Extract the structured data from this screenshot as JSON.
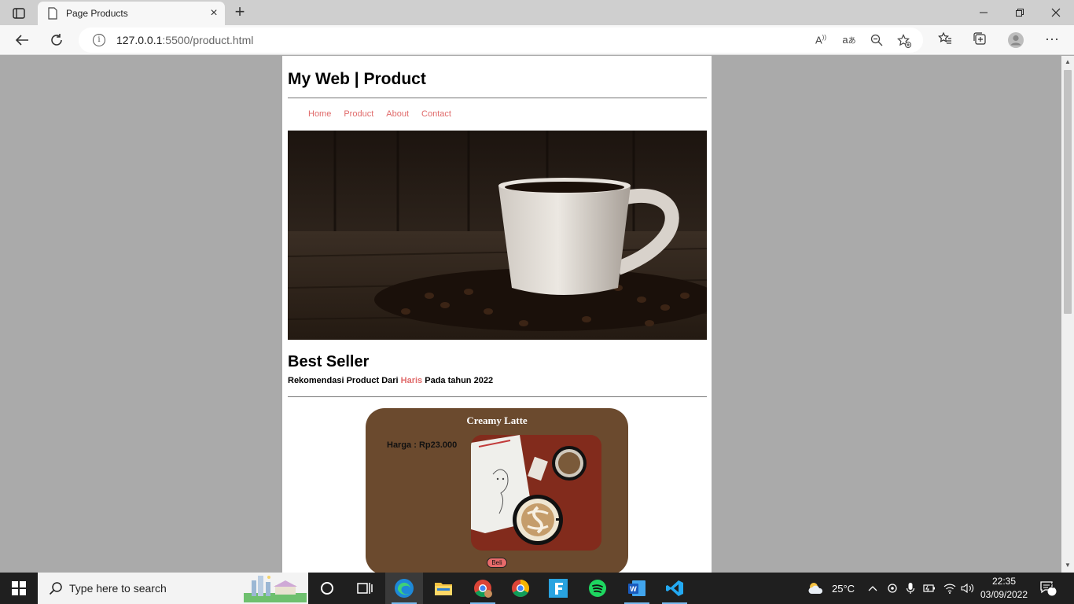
{
  "browser": {
    "tab_title": "Page Products",
    "tab_close": "×",
    "new_tab": "+",
    "url_host": "127.0.0.1",
    "url_rest": ":5500/product.html"
  },
  "site": {
    "title": "My Web | Product",
    "nav": [
      "Home",
      "Product",
      "About",
      "Contact"
    ],
    "best_seller_title": "Best Seller",
    "subtitle_pre": "Rekomendasi Product Dari ",
    "subtitle_name": "Haris",
    "subtitle_post": " Pada tahun 2022",
    "product": {
      "name": "Creamy Latte",
      "price": "Harga : Rp23.000",
      "buy_label": "Beli"
    }
  },
  "taskbar": {
    "search_placeholder": "Type here to search",
    "temperature": "25°C",
    "time": "22:35",
    "date": "03/09/2022",
    "notifications": "4"
  },
  "colors": {
    "accent_link": "#e06a6a",
    "card_bg": "#6b4a2e",
    "page_bg": "#aaaaaa"
  }
}
